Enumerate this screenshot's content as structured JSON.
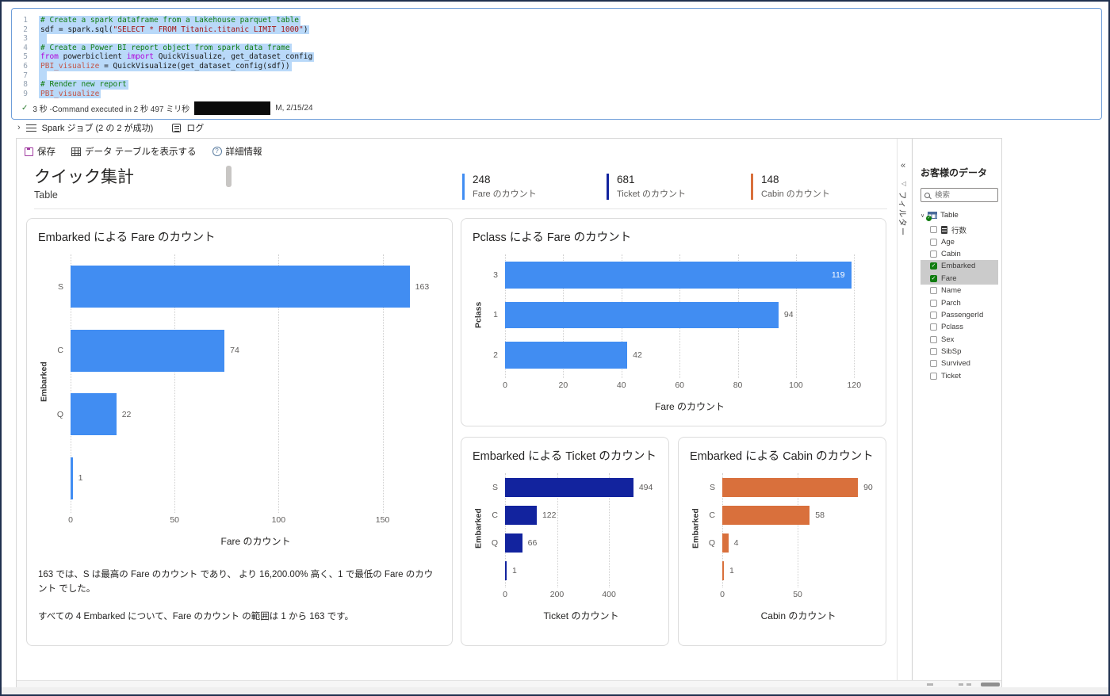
{
  "notebook": {
    "code_cell": {
      "lines": [
        {
          "n": "1",
          "tokens": [
            {
              "t": "comment",
              "s": "# Create a spark dataframe from a Lakehouse parquet table"
            }
          ]
        },
        {
          "n": "2",
          "tokens": [
            {
              "t": "plain",
              "s": "sdf = spark.sql("
            },
            {
              "t": "string",
              "s": "\"SELECT * FROM Titanic.titanic LIMIT 1000\""
            },
            {
              "t": "plain",
              "s": ")"
            }
          ]
        },
        {
          "n": "3",
          "tokens": []
        },
        {
          "n": "4",
          "tokens": [
            {
              "t": "comment",
              "s": "# Create a Power BI report object from spark data frame"
            }
          ]
        },
        {
          "n": "5",
          "tokens": [
            {
              "t": "keyword",
              "s": "from"
            },
            {
              "t": "plain",
              "s": " powerbiclient "
            },
            {
              "t": "keyword",
              "s": "import"
            },
            {
              "t": "plain",
              "s": " QuickVisualize, get_dataset_config"
            }
          ]
        },
        {
          "n": "6",
          "tokens": [
            {
              "t": "var",
              "s": "PBI_visualize"
            },
            {
              "t": "plain",
              "s": " = QuickVisualize(get_dataset_config(sdf))"
            }
          ]
        },
        {
          "n": "7",
          "tokens": []
        },
        {
          "n": "8",
          "tokens": [
            {
              "t": "comment",
              "s": "# Render new report"
            }
          ]
        },
        {
          "n": "9",
          "tokens": [
            {
              "t": "var",
              "s": "PBI_visualize"
            }
          ]
        }
      ],
      "status": {
        "check": "✓",
        "duration": "3 秒 -Command executed in 2 秒 497 ミリ秒",
        "date": "M, 2/15/24"
      }
    },
    "spark_jobs": {
      "expander": "›",
      "label": "Spark ジョブ (2 の 2 が成功)",
      "log_label": "ログ"
    }
  },
  "report": {
    "toolbar": {
      "save": "保存",
      "show_data_table": "データ テーブルを表示する",
      "details": "詳細情報",
      "info_glyph": "?"
    },
    "title": "クイック集計",
    "subtitle": "Table",
    "kpis": [
      {
        "value": "248",
        "label": "Fare のカウント",
        "color": "#418DF2"
      },
      {
        "value": "681",
        "label": "Ticket のカウント",
        "color": "#12239E"
      },
      {
        "value": "148",
        "label": "Cabin のカウント",
        "color": "#D9703C"
      }
    ],
    "narrative": [
      "163 では、S は最高の Fare のカウント であり、 より 16,200.00% 高く、1 で最低の Fare のカウント でした。",
      "すべての 4 Embarked について、Fare のカウント の範囲は 1 から 163 です。"
    ]
  },
  "chart_data": [
    {
      "type": "bar",
      "orientation": "horizontal",
      "title": "Embarked による Fare のカウント",
      "categories": [
        "S",
        "C",
        "Q",
        ""
      ],
      "values": [
        163,
        74,
        22,
        1
      ],
      "xlabel": "Fare のカウント",
      "ylabel": "Embarked",
      "ticks": [
        0,
        50,
        100,
        150
      ],
      "axis_max": 178,
      "color": "#418DF2",
      "value_inside": [
        false,
        false,
        false,
        false
      ],
      "grid": "dotted-vertical"
    },
    {
      "type": "bar",
      "orientation": "horizontal",
      "title": "Pclass による Fare のカウント",
      "categories": [
        "3",
        "1",
        "2"
      ],
      "values": [
        119,
        94,
        42
      ],
      "xlabel": "Fare のカウント",
      "ylabel": "Pclass",
      "ticks": [
        0,
        20,
        40,
        60,
        80,
        100,
        120
      ],
      "axis_max": 127,
      "color": "#418DF2",
      "value_inside": [
        true,
        false,
        false
      ],
      "grid": "dotted-vertical"
    },
    {
      "type": "bar",
      "orientation": "horizontal",
      "title": "Embarked による Ticket のカウント",
      "categories": [
        "S",
        "C",
        "Q",
        ""
      ],
      "values": [
        494,
        122,
        66,
        1
      ],
      "xlabel": "Ticket のカウント",
      "ylabel": "Embarked",
      "ticks": [
        0,
        200,
        400
      ],
      "axis_max": 586,
      "color": "#12239E",
      "value_inside": [
        false,
        false,
        false,
        false
      ],
      "grid": "dotted-vertical"
    },
    {
      "type": "bar",
      "orientation": "horizontal",
      "title": "Embarked による Cabin のカウント",
      "categories": [
        "S",
        "C",
        "Q",
        ""
      ],
      "values": [
        90,
        58,
        4,
        1
      ],
      "xlabel": "Cabin のカウント",
      "ylabel": "Embarked",
      "ticks": [
        0,
        50
      ],
      "axis_max": 101,
      "color": "#D9703C",
      "value_inside": [
        false,
        false,
        false,
        false
      ],
      "grid": "dotted-vertical"
    }
  ],
  "sidebar": {
    "collapse_icon": "«",
    "pin_icon": "◁",
    "filter_label": "フィルター",
    "title": "お客様のデータ",
    "search_placeholder": "検索",
    "tree_chevron": "∨",
    "tree_root": "Table",
    "fields": [
      {
        "label": "行数",
        "icon": "rowcount",
        "checked": false
      },
      {
        "label": "Age",
        "checked": false
      },
      {
        "label": "Cabin",
        "checked": false
      },
      {
        "label": "Embarked",
        "checked": true
      },
      {
        "label": "Fare",
        "checked": true
      },
      {
        "label": "Name",
        "checked": false
      },
      {
        "label": "Parch",
        "checked": false
      },
      {
        "label": "PassengerId",
        "checked": false
      },
      {
        "label": "Pclass",
        "checked": false
      },
      {
        "label": "Sex",
        "checked": false
      },
      {
        "label": "SibSp",
        "checked": false
      },
      {
        "label": "Survived",
        "checked": false
      },
      {
        "label": "Ticket",
        "checked": false
      }
    ]
  }
}
